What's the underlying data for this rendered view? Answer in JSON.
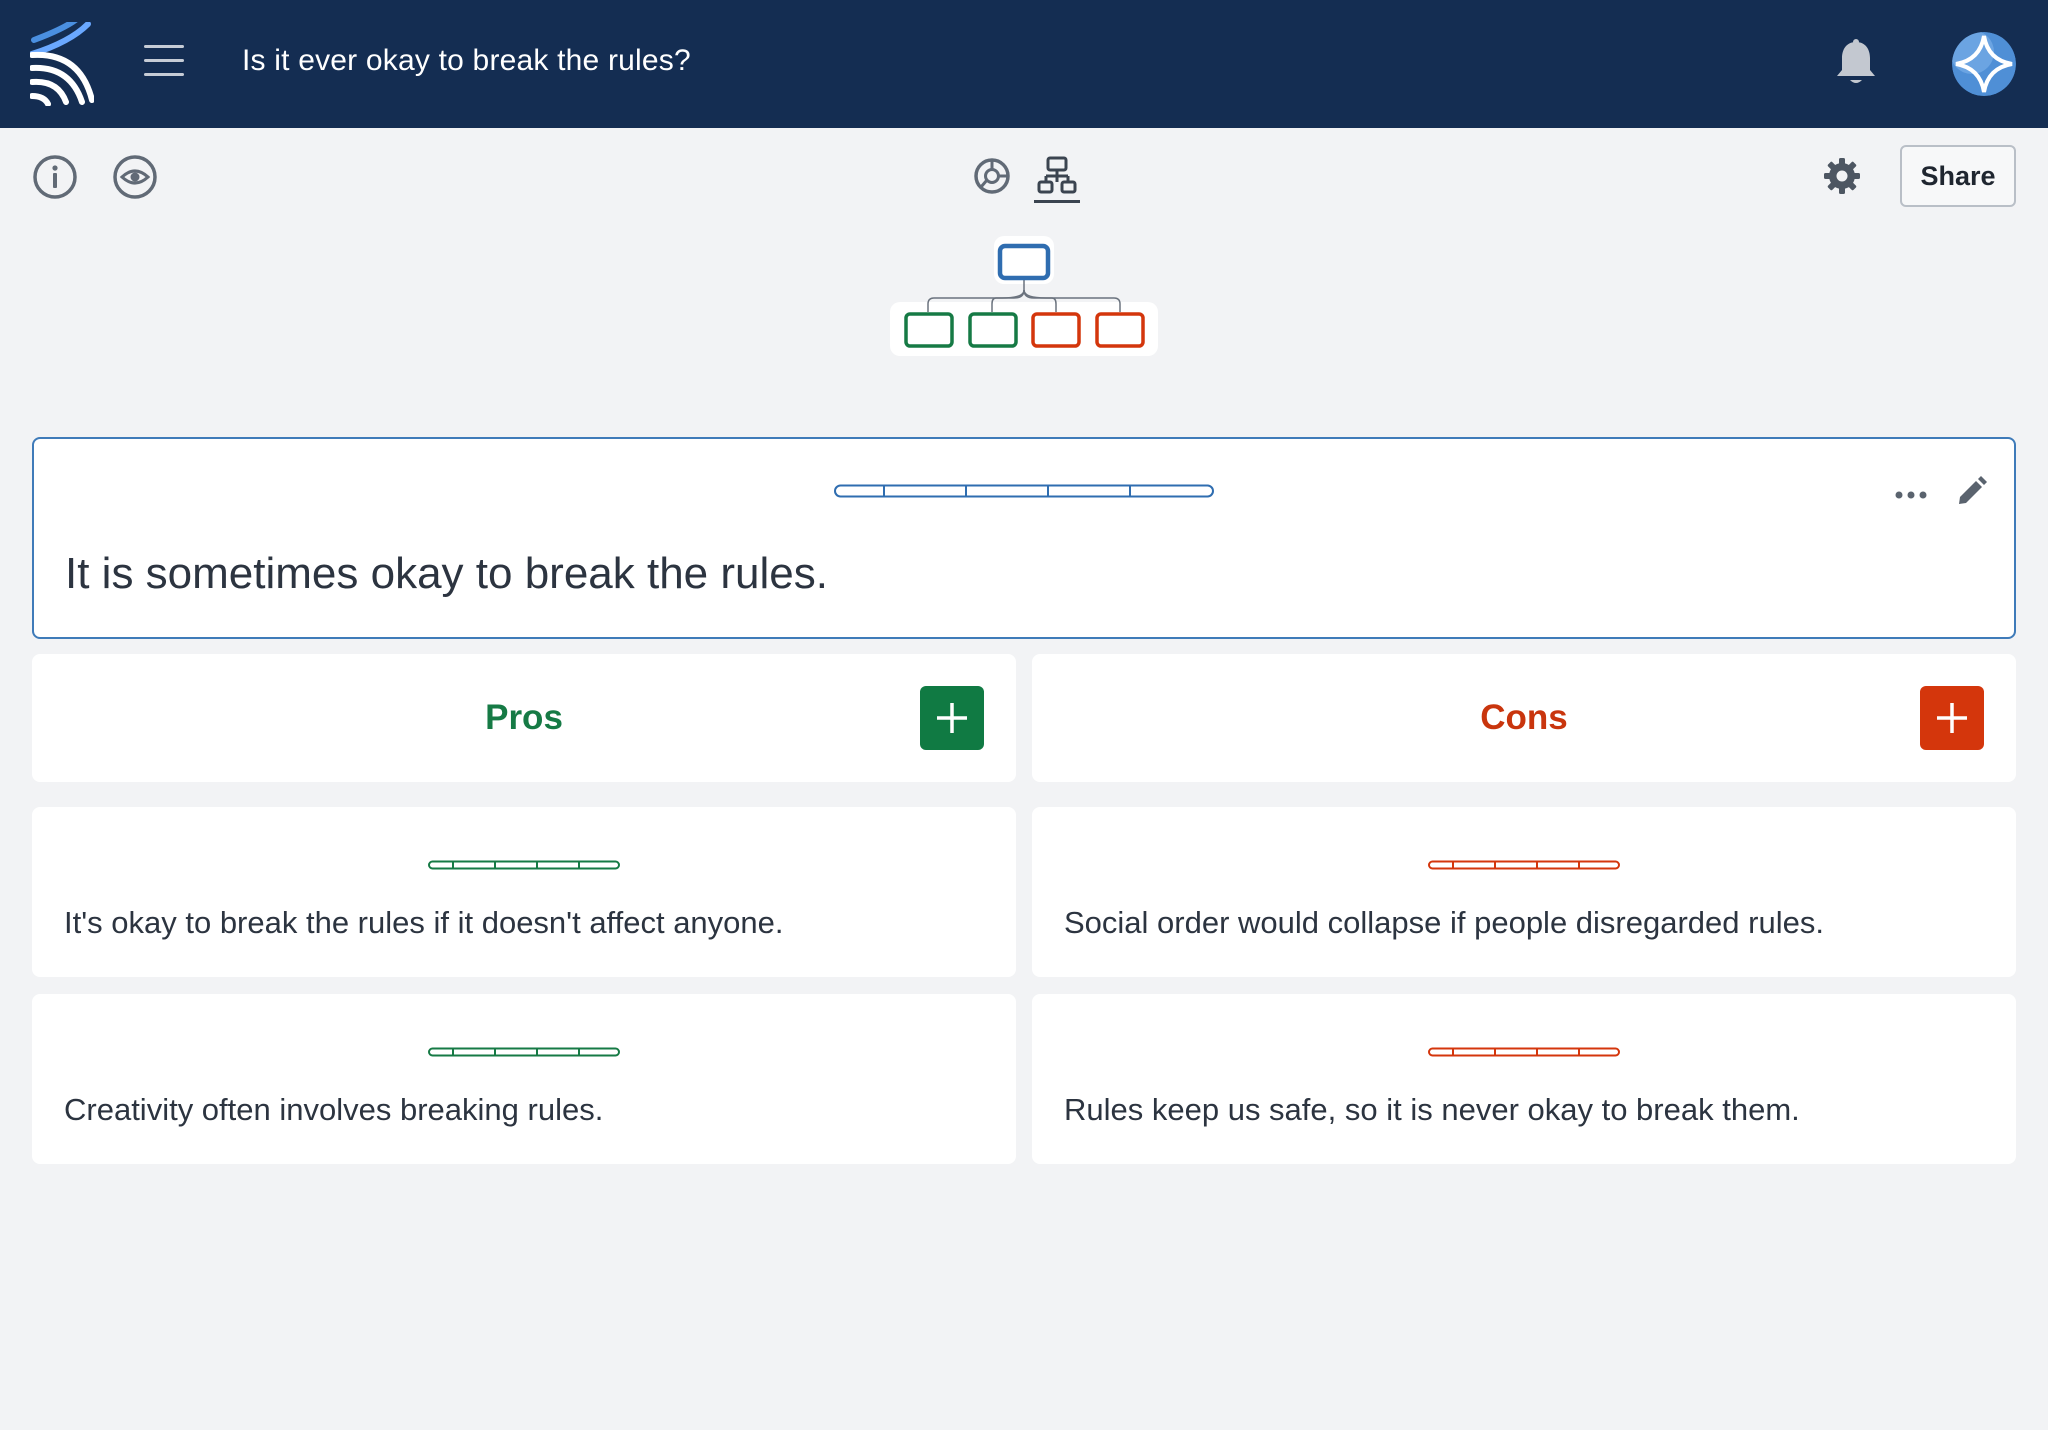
{
  "header": {
    "title": "Is it ever okay to break the rules?",
    "logo_icon": "kialo-logo-icon",
    "menu_icon": "hamburger-menu-icon",
    "notifications_icon": "bell-icon",
    "avatar_icon": "user-avatar"
  },
  "toolbar": {
    "left_icons": [
      "info-icon",
      "eye-icon"
    ],
    "view_icons": [
      "sunburst-view-icon",
      "tree-view-icon"
    ],
    "active_view": "tree-view-icon",
    "settings_icon": "gear-icon",
    "share_label": "Share"
  },
  "main_claim": {
    "text": "It is sometimes okay to break the rules.",
    "more_icon": "more-horizontal-icon",
    "edit_icon": "pencil-icon"
  },
  "columns": {
    "pros": {
      "title": "Pros",
      "add_icon": "plus-icon"
    },
    "cons": {
      "title": "Cons",
      "add_icon": "plus-icon"
    }
  },
  "arguments": {
    "pros": [
      {
        "text": "It's okay to break the rules if it doesn't affect anyone."
      },
      {
        "text": "Creativity often involves breaking rules."
      }
    ],
    "cons": [
      {
        "text": "Social order would collapse if people disregarded rules."
      },
      {
        "text": "Rules keep us safe, so it is never okay to break them."
      }
    ]
  },
  "colors": {
    "header_bg": "#142d52",
    "page_bg": "#f2f3f5",
    "accent_blue": "#2f6db0",
    "pro_green": "#167a45",
    "con_red": "#d4360c"
  }
}
